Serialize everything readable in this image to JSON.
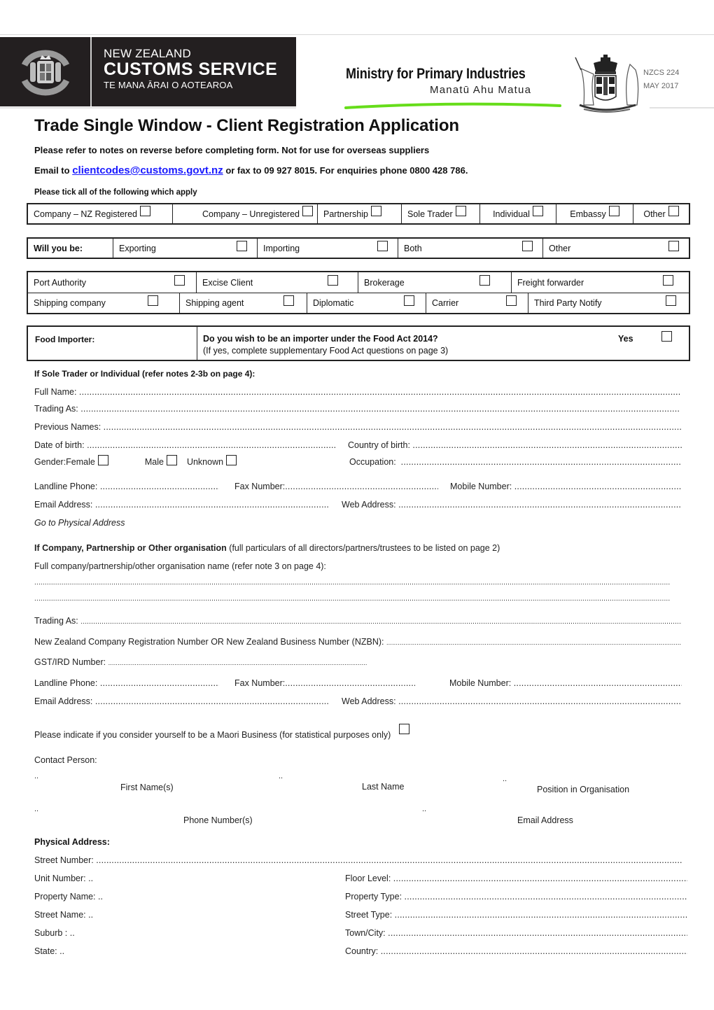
{
  "header": {
    "customs": {
      "crest_icon": "nz-customs-crest-icon",
      "line1": "NEW ZEALAND",
      "line2": "CUSTOMS SERVICE",
      "line3": "TE MANA ĀRAI O AOTEAROA"
    },
    "mpi": {
      "line1": "Ministry for Primary Industries",
      "line2": "Manatū Ahu Matua",
      "accent_color": "#66dd1a"
    },
    "coat_of_arms_icon": "nz-coat-of-arms-icon",
    "form_number": "NZCS 224",
    "form_date": "MAY 2017"
  },
  "title": "Trade Single Window - Client Registration Application",
  "subtitle": "Please refer to notes on reverse before completing form.  Not for use for overseas suppliers",
  "contact": {
    "prefix": "Email to ",
    "email": "clientcodes@customs.govt.nz",
    "suffix": " or fax to 09 927 8015.  For enquiries phone 0800 428 786.",
    "link_color": "#1a1aff"
  },
  "tick_instruction": "Please tick all of the following which apply",
  "entity_types": [
    {
      "label": "Company – NZ Registered",
      "checked": false
    },
    {
      "label": "Company – Unregistered",
      "checked": false
    },
    {
      "label": "Partnership",
      "checked": false
    },
    {
      "label": "Sole Trader",
      "checked": false
    },
    {
      "label": "Individual",
      "checked": false
    },
    {
      "label": "Embassy",
      "checked": false
    },
    {
      "label": "Other",
      "checked": false
    }
  ],
  "will_you_be": {
    "label": "Will you be:",
    "options": [
      {
        "label": "Exporting",
        "checked": false
      },
      {
        "label": "Importing",
        "checked": false
      },
      {
        "label": "Both",
        "checked": false
      },
      {
        "label": "Other",
        "checked": false
      }
    ]
  },
  "roles_row1": [
    {
      "label": "Port Authority",
      "checked": false
    },
    {
      "label": "Excise Client",
      "checked": false
    },
    {
      "label": "Brokerage",
      "checked": false
    },
    {
      "label": "Freight forwarder",
      "checked": false
    }
  ],
  "roles_row2": [
    {
      "label": "Shipping company",
      "checked": false
    },
    {
      "label": "Shipping agent",
      "checked": false
    },
    {
      "label": "Diplomatic",
      "checked": false
    },
    {
      "label": "Carrier",
      "checked": false
    },
    {
      "label": "Third Party Notify",
      "checked": false
    }
  ],
  "food_importer": {
    "label": "Food Importer:",
    "question": "Do you wish to be an importer under the Food Act 2014?",
    "note": "(If yes, complete supplementary Food Act questions on page 3)",
    "yes_label": "Yes",
    "checked": false
  },
  "individual": {
    "heading": "If Sole Trader or Individual (refer notes 2-3b on page 4):",
    "full_name": "Full Name:",
    "trading_as": "Trading As:",
    "previous_names": "Previous Names:",
    "date_of_birth": "Date of birth:",
    "country_of_birth": "Country of birth:",
    "gender_label": "Gender:",
    "gender_options": [
      "Female",
      "Male",
      "Unknown"
    ],
    "occupation": "Occupation:",
    "landline": "Landline Phone:",
    "fax": "Fax Number:",
    "mobile": "Mobile Number:",
    "email": "Email Address:",
    "web": "Web Address:",
    "goto_link": "Go to Physical Address"
  },
  "company": {
    "heading_bold": "If Company, Partnership or Other organisation",
    "heading_note": " (full particulars of all directors/partners/trustees to be listed on page 2)",
    "name_label": "Full company/partnership/other organisation name (refer note 3 on page 4):",
    "trading_as": "Trading As:",
    "nzbn": "New Zealand Company Registration Number OR New Zealand Business Number (NZBN):",
    "gst": "GST/IRD Number:",
    "landline": "Landline Phone:",
    "fax": "Fax Number:",
    "mobile": "Mobile Number:",
    "email": "Email Address:",
    "web": "Web Address:",
    "maori_business": "Please indicate if you consider yourself to be a Maori Business (for statistical purposes only)",
    "maori_checked": false,
    "contact_person": "Contact Person:",
    "contact_captions": {
      "first_name": "First Name(s)",
      "last_name": "Last Name",
      "position": "Position in Organisation",
      "phone": "Phone Number(s)",
      "email": "Email Address"
    },
    "placeholder_dots": ".."
  },
  "physical_address": {
    "heading": "Physical Address:",
    "street_number": "Street Number:",
    "unit_number": "Unit Number:",
    "floor_level": "Floor Level:",
    "property_name": "Property Name:",
    "property_type": "Property Type:",
    "street_name": "Street Name:",
    "street_type": "Street Type:",
    "suburb": "Suburb :",
    "town_city": "Town/City:",
    "state": "State:",
    "country": "Country:",
    "short_dots": ".."
  }
}
